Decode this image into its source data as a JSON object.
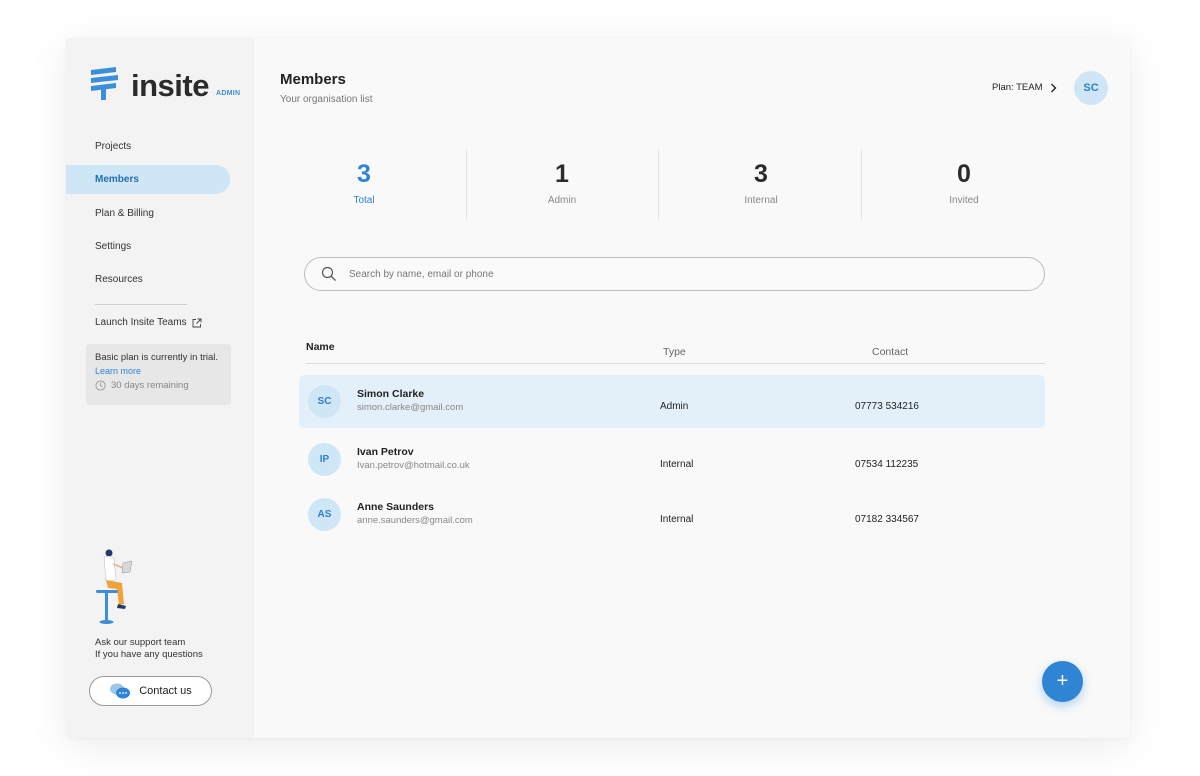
{
  "brand": {
    "name": "insite",
    "badge": "ADMIN",
    "color": "#2f85d3"
  },
  "sidebar": {
    "items": [
      {
        "label": "Projects"
      },
      {
        "label": "Members",
        "active": true
      },
      {
        "label": "Plan & Billing"
      },
      {
        "label": "Settings"
      },
      {
        "label": "Resources"
      }
    ],
    "launch_label": "Launch Insite Teams",
    "trial": {
      "title": "Basic plan is currently in trial.",
      "link": "Learn more",
      "days": "30 days remaining"
    },
    "support": {
      "line1": "Ask our support team",
      "line2": "If you have any questions"
    },
    "contact_label": "Contact us"
  },
  "header": {
    "title": "Members",
    "subtitle": "Your organisation list",
    "plan_label": "Plan: TEAM",
    "user_initials": "SC"
  },
  "stats": [
    {
      "value": "3",
      "label": "Total"
    },
    {
      "value": "1",
      "label": "Admin"
    },
    {
      "value": "3",
      "label": "Internal"
    },
    {
      "value": "0",
      "label": "Invited"
    }
  ],
  "search": {
    "placeholder": "Search by name, email or phone",
    "value": ""
  },
  "table": {
    "columns": {
      "name": "Name",
      "type": "Type",
      "contact": "Contact"
    },
    "rows": [
      {
        "initials": "SC",
        "name": "Simon Clarke",
        "email": "simon.clarke@gmail.com",
        "type": "Admin",
        "contact": "07773 534216",
        "selected": true
      },
      {
        "initials": "IP",
        "name": "Ivan Petrov",
        "email": "Ivan.petrov@hotmail.co.uk",
        "type": "Internal",
        "contact": "07534 112235"
      },
      {
        "initials": "AS",
        "name": "Anne Saunders",
        "email": "anne.saunders@gmail.com",
        "type": "Internal",
        "contact": "07182 334567"
      }
    ]
  },
  "fab_label": "+"
}
